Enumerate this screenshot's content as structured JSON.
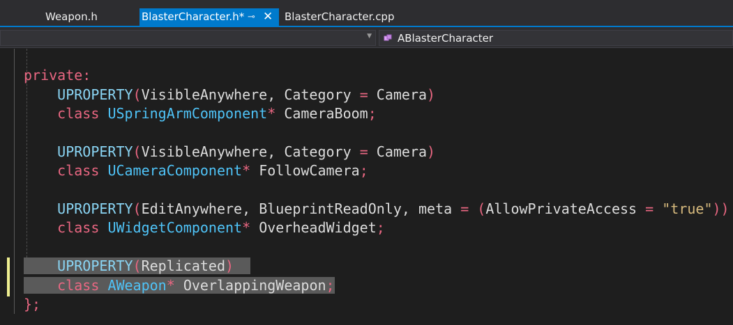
{
  "tabs": [
    {
      "label": "Weapon.h",
      "active": false
    },
    {
      "label": "BlasterCharacter.h*",
      "active": true,
      "pin_glyph": "⊸",
      "close_glyph": "✕"
    },
    {
      "label": "BlasterCharacter.cpp",
      "active": false
    }
  ],
  "navbar": {
    "left_dropdown_glyph": "▼",
    "scope_label": "ABlasterCharacter",
    "scope_icon": "class-icon"
  },
  "code": {
    "private_kw": "private",
    "colon": ":",
    "uproperty": "UPROPERTY",
    "class_kw": "class",
    "visible_anywhere": "VisibleAnywhere",
    "category": "Category",
    "camera": "Camera",
    "spring_arm_type": "USpringArmComponent",
    "camera_boom": "CameraBoom",
    "camera_component_type": "UCameraComponent",
    "follow_camera": "FollowCamera",
    "edit_anywhere": "EditAnywhere",
    "blueprint_read_only": "BlueprintReadOnly",
    "meta": "meta",
    "allow_private_access": "AllowPrivateAccess",
    "true_string": "\"true\"",
    "widget_component_type": "UWidgetComponent",
    "overhead_widget": "OverheadWidget",
    "replicated": "Replicated",
    "weapon_type": "AWeapon",
    "overlapping_weapon": "OverlappingWeapon",
    "closing": "};"
  },
  "colors": {
    "keyword": "#ea6782",
    "type": "#4fc3f7",
    "macro": "#8ad5f4",
    "string": "#d7ba7d",
    "accent": "#007acc",
    "selection": "#5a5a5a",
    "change_marker": "#efef91"
  }
}
